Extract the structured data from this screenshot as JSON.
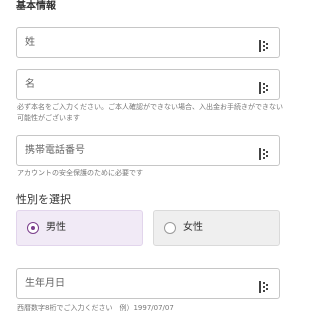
{
  "section_title": "基本情報",
  "fields": {
    "last_name": {
      "placeholder": "姓"
    },
    "first_name": {
      "placeholder": "名"
    },
    "name_note_line1": "必ず本名をご入力ください。ご本人確認ができない場合、入出金お手続きができない",
    "name_note_line2": "可能性がございます",
    "phone": {
      "placeholder": "携帯電話番号"
    },
    "phone_note": "アカウントの安全保護のために必要です",
    "birthdate": {
      "placeholder": "生年月日"
    },
    "birthdate_note": "西暦数字8桁でご入力ください　例）1997/07/07"
  },
  "gender": {
    "title": "性別を選択",
    "options": [
      {
        "label": "男性",
        "selected": true
      },
      {
        "label": "女性",
        "selected": false
      }
    ]
  },
  "icons": {
    "field_icon": "password-dots-icon"
  },
  "colors": {
    "accent": "#7b3f8c",
    "selected_bg": "#f1eaf6",
    "unselected_bg": "#efefef"
  }
}
